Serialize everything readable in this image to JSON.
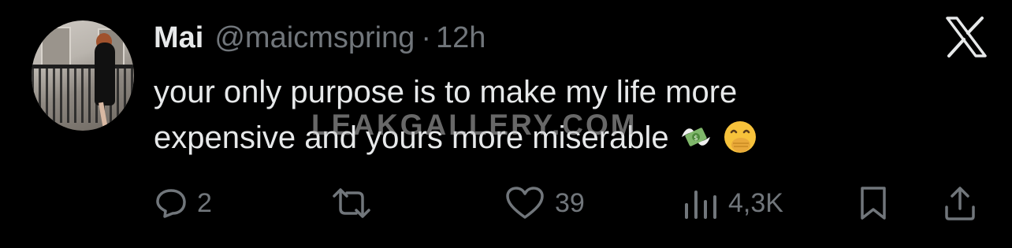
{
  "tweet": {
    "display_name": "Mai",
    "handle": "@maicmspring",
    "separator": "·",
    "time": "12h",
    "text_line1": "your only purpose is to make my life more",
    "text_line2": "expensive and yours more miserable",
    "emojis": [
      "money-with-wings-icon",
      "face-with-hand-over-mouth-icon"
    ]
  },
  "watermark": "LEAKGALLERY.COM",
  "actions": {
    "reply_count": "2",
    "repost_count": "",
    "like_count": "39",
    "views_count": "4,3K"
  },
  "colors": {
    "background": "#000000",
    "text": "#e7e9ea",
    "muted": "#71767b"
  }
}
